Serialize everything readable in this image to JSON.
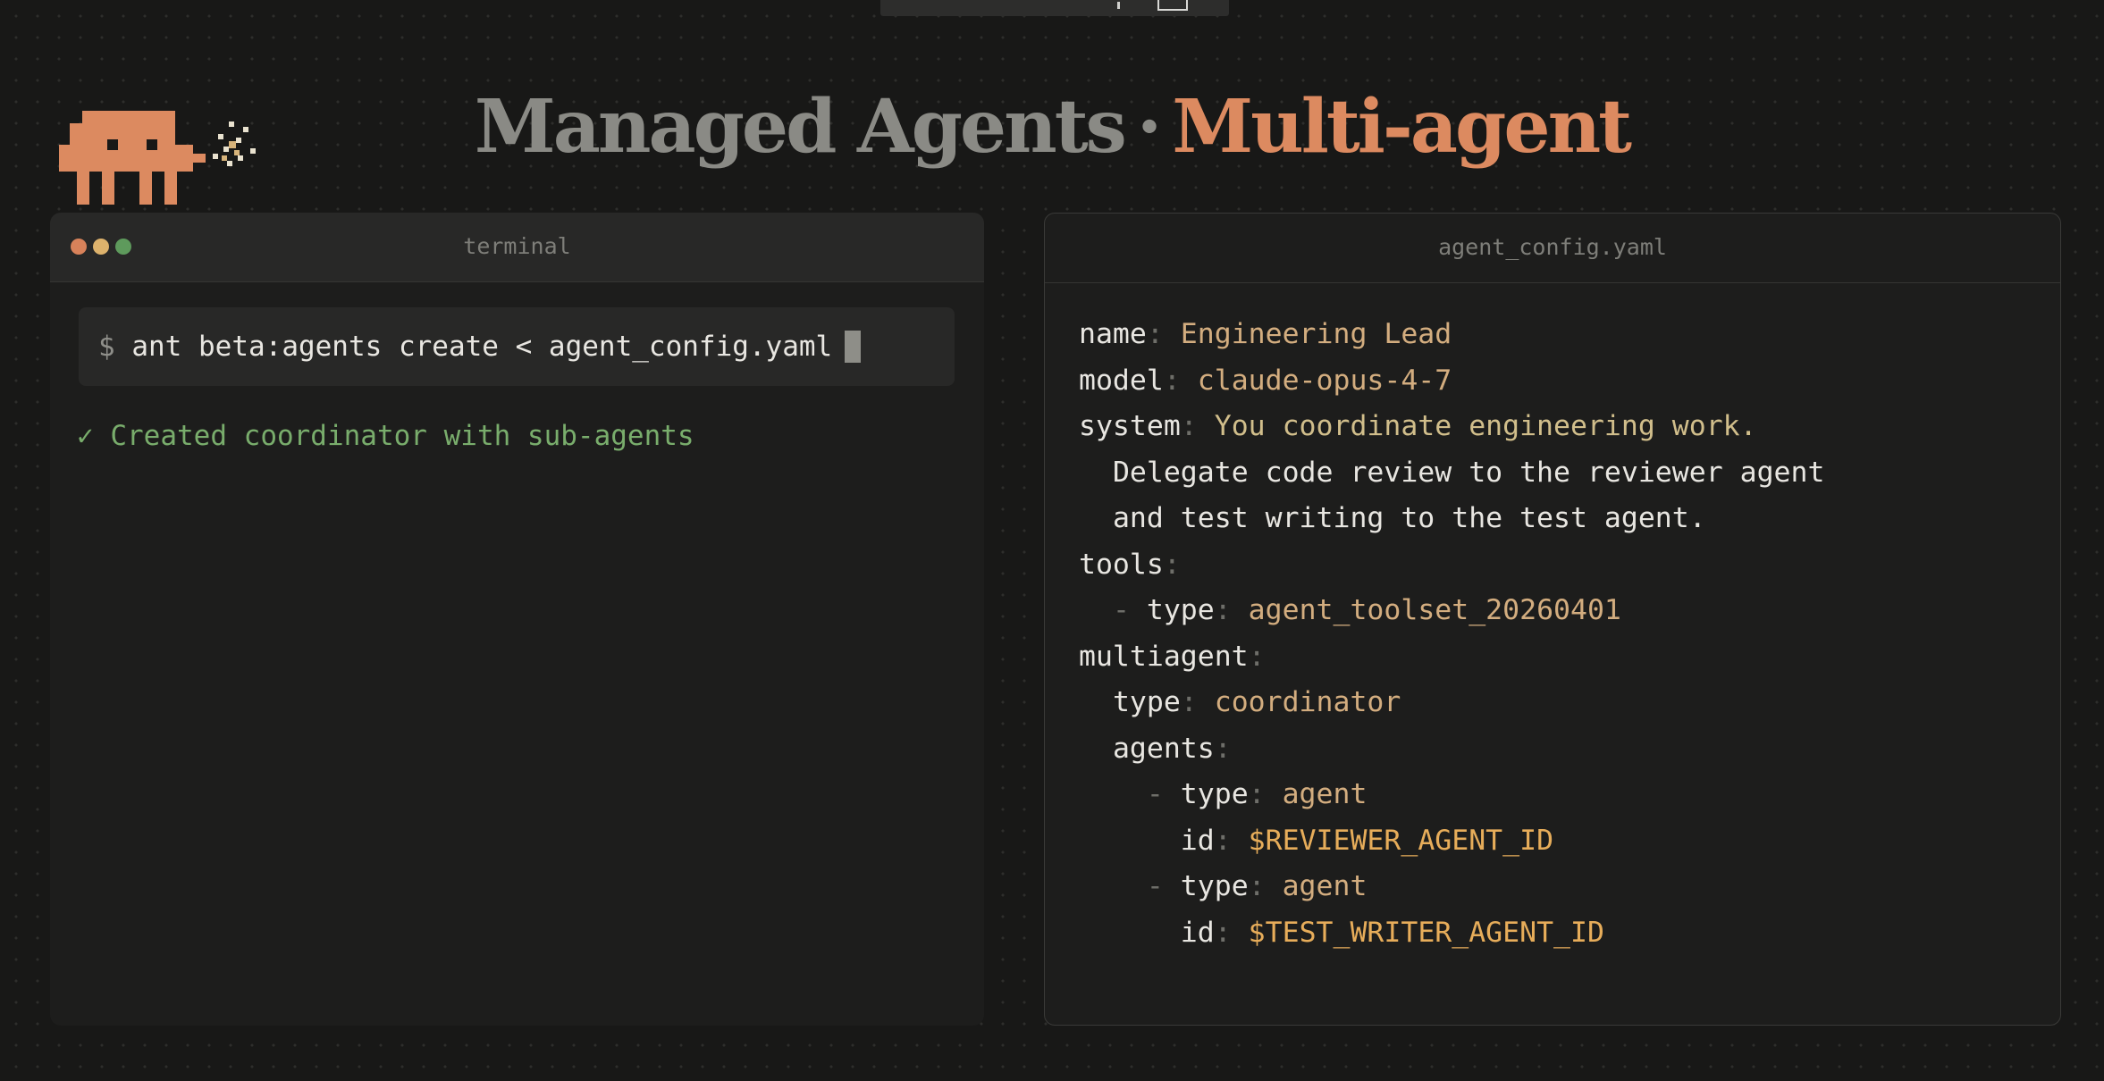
{
  "page": {
    "title_main": "Managed Agents",
    "title_separator": "·",
    "title_accent": "Multi-agent"
  },
  "icons": {
    "mascot": "pixel-crab-mascot-icon",
    "sparkle": "pixel-sparkle-icon",
    "window_controls": "traffic-light-dots"
  },
  "colors": {
    "background": "#181817",
    "accent": "#dc8a60",
    "success": "#79ad6c",
    "yaml_value": "#d3ad7f",
    "yaml_variable": "#e7ad5a"
  },
  "terminal": {
    "title": "terminal",
    "prompt": "$",
    "command": "ant beta:agents create < agent_config.yaml",
    "output_check": "✓",
    "output": "Created coordinator with sub-agents"
  },
  "config": {
    "title": "agent_config.yaml",
    "lines": {
      "name_key": "name",
      "name_value": "Engineering Lead",
      "model_key": "model",
      "model_value": "claude-opus-4-7",
      "system_key": "system",
      "system_value_1": "You coordinate engineering work.",
      "system_value_2": "Delegate code review to the reviewer agent",
      "system_value_3": "and test writing to the test agent.",
      "tools_key": "tools",
      "tools_type_key": "type",
      "tools_type_value": "agent_toolset_20260401",
      "multiagent_key": "multiagent",
      "multiagent_type_key": "type",
      "multiagent_type_value": "coordinator",
      "agents_key": "agents",
      "agent1_type_key": "type",
      "agent1_type_value": "agent",
      "agent1_id_key": "id",
      "agent1_id_value": "$REVIEWER_AGENT_ID",
      "agent2_type_key": "type",
      "agent2_type_value": "agent",
      "agent2_id_key": "id",
      "agent2_id_value": "$TEST_WRITER_AGENT_ID"
    },
    "colon": ":",
    "dash": "-"
  }
}
